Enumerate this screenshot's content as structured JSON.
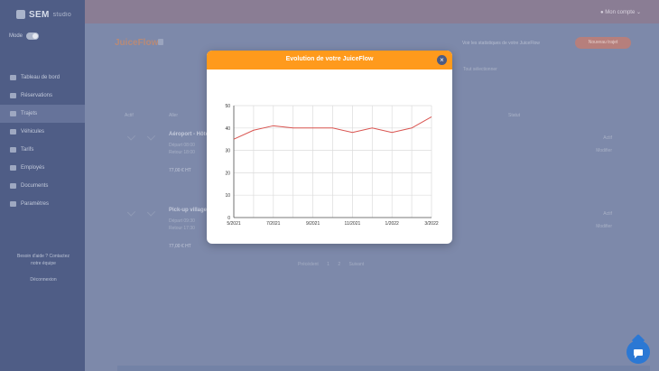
{
  "app": {
    "logo": "SEM",
    "logo_sub": "studio",
    "user": "Mon compte"
  },
  "sidebar": {
    "toggle_label": "Mode",
    "items": [
      {
        "label": "Tableau de bord",
        "active": false
      },
      {
        "label": "Réservations",
        "active": false
      },
      {
        "label": "Trajets",
        "active": true
      },
      {
        "label": "Véhicules",
        "active": false
      },
      {
        "label": "Tarifs",
        "active": false
      },
      {
        "label": "Employés",
        "active": false
      },
      {
        "label": "Documents",
        "active": false
      },
      {
        "label": "Paramètres",
        "active": false
      }
    ],
    "footer_line1": "Besoin d'aide ? Contactez",
    "footer_line2": "notre équipe",
    "footer_line3": "Déconnexion"
  },
  "page": {
    "title": "JuiceFlow",
    "header_link": "Voir les statistiques de votre JuiceFlow",
    "header_button": "Nouveau trajet",
    "tab_right": "Tout sélectionner",
    "columns": [
      "Actif",
      "Aller",
      "Type",
      "Date",
      "Statut"
    ],
    "rows": [
      {
        "title": "Aéroport - Hôtel",
        "sub1": "Départ 08:00",
        "sub2": "Retour 18:00",
        "price": "77,00 € HT",
        "right1": "Actif",
        "right2": "Modifier"
      },
      {
        "title": "Pick-up village",
        "sub1": "Départ 09:30",
        "sub2": "Retour 17:30",
        "price": "77,00 € HT",
        "right1": "Actif",
        "right2": "Modifier"
      }
    ],
    "pager": "Précédent 1 2 Suivant"
  },
  "modal": {
    "title": "Evolution de votre JuiceFlow",
    "close_label": "×",
    "header_color": "#ff9a1c"
  },
  "chart_data": {
    "type": "line",
    "title": "",
    "xlabel": "",
    "ylabel": "",
    "x": [
      "5/2021",
      "6/2021",
      "7/2021",
      "8/2021",
      "9/2021",
      "10/2021",
      "11/2021",
      "12/2021",
      "1/2022",
      "2/2022",
      "3/2022"
    ],
    "x_tick_labels": [
      "5/2021",
      "7/2021",
      "9/2021",
      "11/2021",
      "1/2022",
      "3/2022"
    ],
    "series": [
      {
        "values": [
          35,
          39,
          41,
          40,
          40,
          40,
          38,
          40,
          38,
          40,
          45
        ],
        "color": "#d9534f"
      }
    ],
    "ylim": [
      0,
      50
    ],
    "y_ticks": [
      0,
      10,
      20,
      30,
      40,
      50
    ],
    "grid": true
  }
}
